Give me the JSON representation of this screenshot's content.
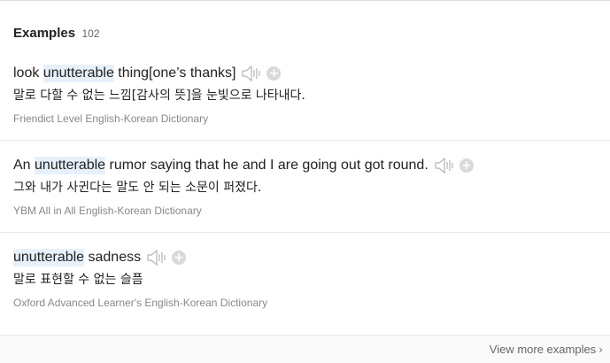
{
  "header": {
    "title": "Examples",
    "count": "102"
  },
  "examples": [
    {
      "en_before": "look ",
      "en_highlight": "unutterable",
      "en_after": " thing[one’s thanks]",
      "ko": "말로 다할 수 없는 느낌[감사의 뜻]을 눈빛으로 나타내다.",
      "source": "Friendict Level English-Korean Dictionary"
    },
    {
      "en_before": "An ",
      "en_highlight": "unutterable",
      "en_after": " rumor saying that he and I are going out got round.",
      "ko": "그와 내가 사귄다는 말도 안 되는 소문이 퍼졌다.",
      "source": "YBM All in All English-Korean Dictionary"
    },
    {
      "en_before": "",
      "en_highlight": "unutterable",
      "en_after": " sadness",
      "ko": "말로 표현할 수 없는 슬픔",
      "source": "Oxford Advanced Learner's English-Korean Dictionary"
    }
  ],
  "footer": {
    "view_more": "View more examples"
  },
  "icons": {
    "speaker": "speaker-icon",
    "plus": "add-icon",
    "chevron": "chevron-right-icon"
  },
  "colors": {
    "highlight": "#e6f1fb",
    "source_text": "#888888",
    "icon_gray": "#b5b5b5"
  }
}
